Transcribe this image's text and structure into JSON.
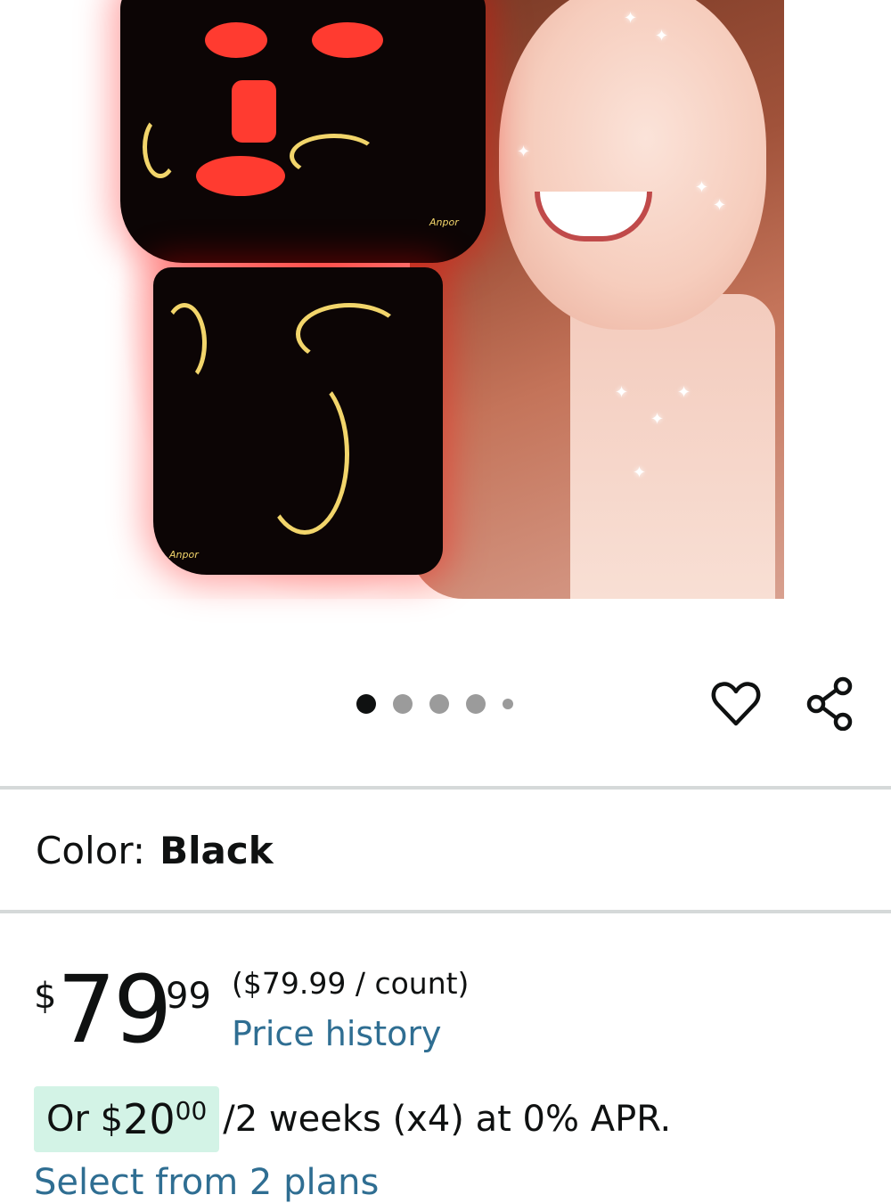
{
  "product_image": {
    "brand_mark_upper": "Anpor",
    "brand_mark_lower": "Anpor",
    "carousel": {
      "total": 5,
      "active_index": 0
    }
  },
  "actions": {
    "wishlist_icon": "heart-outline-icon",
    "share_icon": "share-icon"
  },
  "variation": {
    "label": "Color:",
    "value": "Black"
  },
  "price": {
    "currency_symbol": "$",
    "whole": "79",
    "fraction": "99",
    "unit_price": "($79.99 / count)",
    "history_link": "Price history"
  },
  "installment": {
    "prefix": "Or $",
    "amount_whole": "20",
    "amount_fraction": "00",
    "terms": "/2 weeks (x4) at 0% APR.",
    "select_link": "Select from 2 plans"
  },
  "colors": {
    "link": "#2f6e92",
    "installment_bg": "#d3f3e6",
    "divider": "#d5d9d9",
    "mask_accent": "#f2d56b",
    "glow_red": "#ff3b30"
  }
}
